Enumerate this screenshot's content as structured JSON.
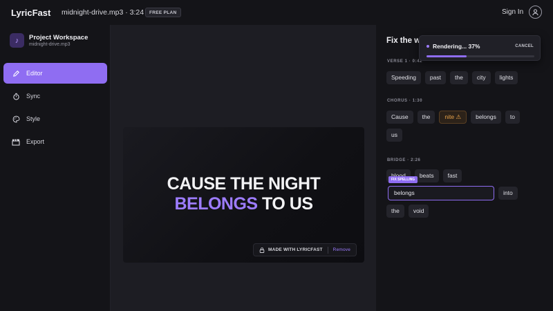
{
  "app": {
    "brand": "LyricFast"
  },
  "header": {
    "filename": "midnight-drive.mp3 · 3:24",
    "plan_badge": "FREE PLAN",
    "signin_label": "Sign In",
    "user_icon": "user-circle-icon"
  },
  "project": {
    "title": "Project Workspace",
    "subtitle": "midnight-drive.mp3",
    "icon": "music-note-icon"
  },
  "sidebar": {
    "items": [
      {
        "label": "Editor",
        "icon": "pencil-icon",
        "active": true
      },
      {
        "label": "Sync",
        "icon": "stopwatch-icon",
        "active": false
      },
      {
        "label": "Style",
        "icon": "palette-icon",
        "active": false
      },
      {
        "label": "Export",
        "icon": "clapperboard-icon",
        "active": false
      }
    ]
  },
  "preview": {
    "line1": "CAUSE THE NIGHT",
    "line2_highlight": "BELONGS",
    "line2_rest": " TO US",
    "watermark": "MADE WITH LYRICFAST",
    "remove_label": "Remove"
  },
  "panel": {
    "title": "Fix the words",
    "sections": [
      {
        "label": "VERSE 1 · 0:42",
        "words": [
          "Speeding",
          "past",
          "the",
          "city",
          "lights"
        ]
      },
      {
        "label": "CHORUS · 1:30",
        "words": [
          "Cause",
          "the",
          "nite ⚠",
          "belongs",
          "to",
          "us"
        ]
      },
      {
        "label": "BRIDGE · 2:26",
        "words": [
          "blood",
          "beats",
          "fast"
        ]
      }
    ],
    "fix_badge": "FIX SPELLING",
    "edit_value": "belongs",
    "after_words": [
      "into",
      "the",
      "void"
    ]
  },
  "render": {
    "status": "Rendering... 37%",
    "cancel_label": "CANCEL",
    "progress": 0.37
  },
  "colors": {
    "accent": "#8f6df2",
    "warning": "#e8a34a"
  }
}
